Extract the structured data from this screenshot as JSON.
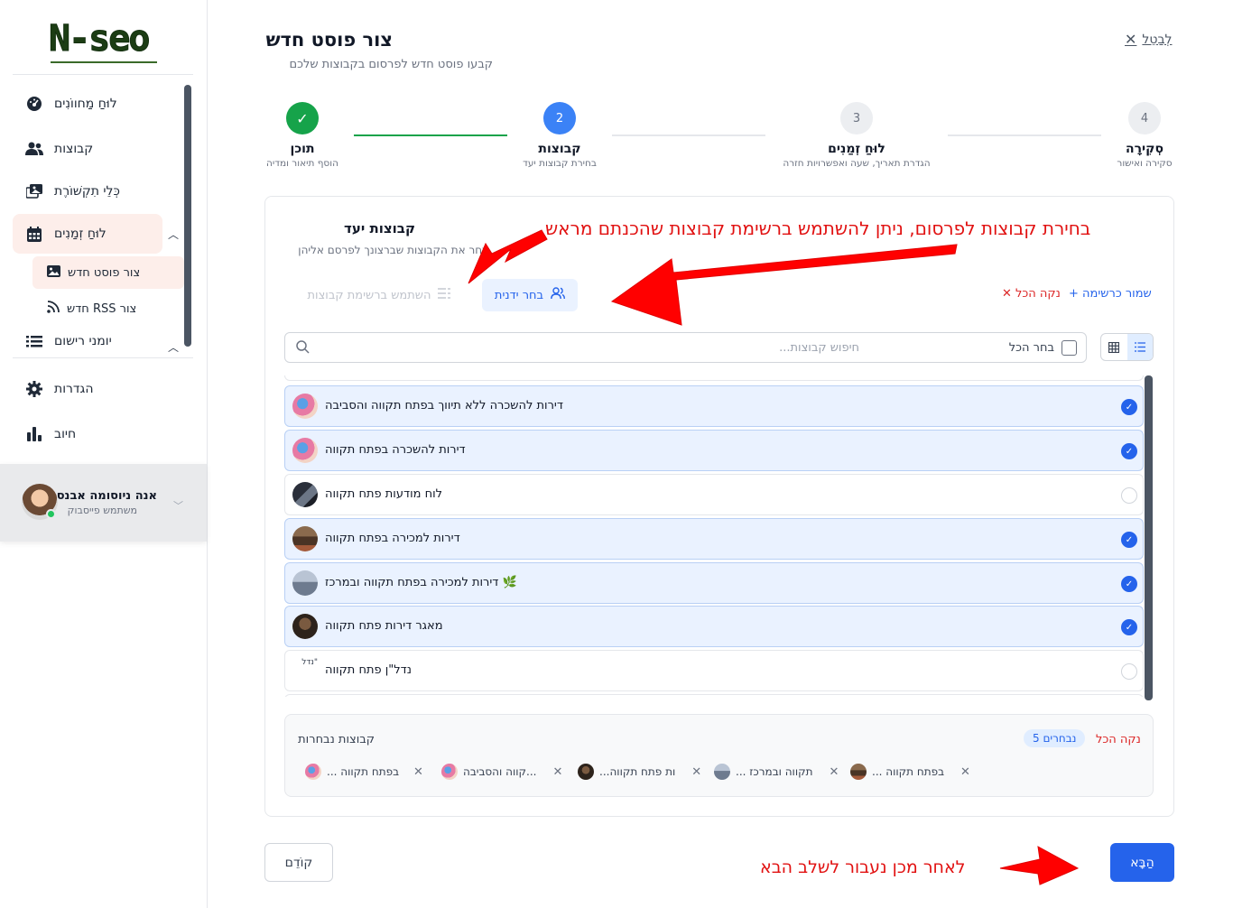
{
  "sidebar": {
    "logo_text": "N-seo",
    "items": [
      {
        "label": "לוּחַ מַחווֹנִים",
        "icon": "dashboard-icon"
      },
      {
        "label": "קבוצות",
        "icon": "users-icon"
      },
      {
        "label": "כְּלֵי תִקְשׁוֹרֶת",
        "icon": "media-icon"
      },
      {
        "label": "לוּחַ זְמַנִים",
        "icon": "calendar-icon"
      },
      {
        "label": "יומני רישום",
        "icon": "list-icon"
      },
      {
        "label": "הגדרות",
        "icon": "gear-icon"
      },
      {
        "label": "חיוב",
        "icon": "chart-icon"
      }
    ],
    "sub_items": [
      {
        "label": "צור פוסט חדש",
        "icon": "image-icon"
      },
      {
        "label": "חדש RSS צור",
        "icon": "rss-icon"
      }
    ],
    "user": {
      "name": "אנה ניוסומה אבנס",
      "role": "משתמש פייסבוק"
    }
  },
  "header": {
    "title": "צור פוסט חדש",
    "subtitle": "קבעו פוסט חדש לפרסום בקבוצות שלכם",
    "cancel_label": "לְבַטֵל"
  },
  "stepper": {
    "steps": [
      {
        "num": "✓",
        "title": "תוכן",
        "desc": "הוסף תיאור ומדיה",
        "state": "done"
      },
      {
        "num": "2",
        "title": "קבוצות",
        "desc": "בחירת קבוצות יעד",
        "state": "current"
      },
      {
        "num": "3",
        "title": "לוּחַ זְמַנִים",
        "desc": "הגדרת תאריך, שעה ואפשרויות חזרה",
        "state": "todo"
      },
      {
        "num": "4",
        "title": "סְקִירָה",
        "desc": "סקירה ואישור",
        "state": "todo"
      }
    ]
  },
  "card": {
    "title": "קבוצות יעד",
    "subtitle": "בחר את הקבוצות שברצונך לפרסם אליהן",
    "tab_manual": "בחר ידנית",
    "tab_list": "השתמש ברשימת קבוצות",
    "save_list": "שמור כרשימה",
    "clear_all": "נקה הכל",
    "search_placeholder": "חיפוש קבוצות...",
    "select_all": "בחר הכל",
    "groups": [
      {
        "name": "דירות להשכרה ללא תיווך בפתח תקווה והסביבה",
        "selected": true,
        "thumb": "#e77aa4"
      },
      {
        "name": "דירות להשכרה בפתח תקווה",
        "selected": true,
        "thumb": "#e77aa4"
      },
      {
        "name": "לוח מודעות פתח תקווה",
        "selected": false,
        "thumb": "#3a3f4a"
      },
      {
        "name": "דירות למכירה בפתח תקווה",
        "selected": true,
        "thumb": "#6b4a34"
      },
      {
        "name": "דירות למכירה בפתח תקווה ובמרכז 🌿",
        "selected": true,
        "thumb": "#8a96a8"
      },
      {
        "name": "מאגר דירות פתח תקווה",
        "selected": true,
        "thumb": "#4a3a2c"
      },
      {
        "name": "נדל\"ן פתח תקווה",
        "selected": false,
        "thumb": "#ffffff",
        "thumb_alt": "נדל\""
      }
    ],
    "selected_panel": {
      "title": "קבוצות נבחרות",
      "count": "5 נבחרים",
      "clear": "נקה הכל",
      "chips": [
        {
          "label": "... בפתח תקווה",
          "thumb": "#e77aa4"
        },
        {
          "label": "קווה והסביבה...",
          "thumb": "#e77aa4"
        },
        {
          "label": "...ות פתח תקווה",
          "thumb": "#4a3a2c"
        },
        {
          "label": "... תקווה ובמרכז",
          "thumb": "#8a96a8"
        },
        {
          "label": "... בפתח תקווה",
          "thumb": "#6b4a34"
        }
      ]
    }
  },
  "footer": {
    "prev_label": "קוֹדֵם",
    "next_label": "הַבָּא"
  },
  "annotations": {
    "top": "בחירת קבוצות לפרסום, ניתן להשתמש ברשימת קבוצות שהכנתם מראש",
    "bottom": "לאחר מכן נעבור לשלב הבא",
    "color": "#e11111"
  },
  "colors": {
    "primary": "#2563eb",
    "success": "#16a34a",
    "danger": "#dc2626",
    "active_nav_bg": "#fdeeea"
  }
}
